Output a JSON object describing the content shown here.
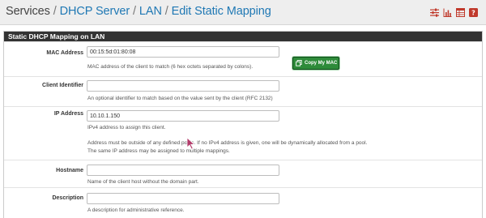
{
  "breadcrumb": {
    "root": "Services",
    "sep": "/",
    "item1": "DHCP Server",
    "item2": "LAN",
    "item3": "Edit Static Mapping"
  },
  "toolbar_icons": [
    "settings-sliders-icon",
    "bar-chart-icon",
    "table-icon",
    "help-icon"
  ],
  "panel": {
    "title": "Static DHCP Mapping on LAN"
  },
  "form": {
    "mac": {
      "label": "MAC Address",
      "value": "00:15:5d:01:80:08",
      "button": "Copy My MAC",
      "help": "MAC address of the client to match (6 hex octets separated by colons)."
    },
    "client_id": {
      "label": "Client Identifier",
      "value": "",
      "help": "An optional identifier to match based on the value sent by the client (RFC 2132)"
    },
    "ip": {
      "label": "IP Address",
      "value": "10.10.1.150",
      "help": "IPv4 address to assign this client.",
      "help2": "Address must be outside of any defined pools. If no IPv4 address is given, one will be dynamically allocated from a pool.",
      "help3": "The same IP address may be assigned to multiple mappings."
    },
    "hostname": {
      "label": "Hostname",
      "value": "",
      "help": "Name of the client host without the domain part."
    },
    "description": {
      "label": "Description",
      "value": "",
      "help": "A description for administrative reference."
    }
  },
  "colors": {
    "link": "#1f78b4",
    "panel_header": "#333333",
    "copy_button": "#2e8b3a",
    "icon_red": "#c0392b"
  }
}
